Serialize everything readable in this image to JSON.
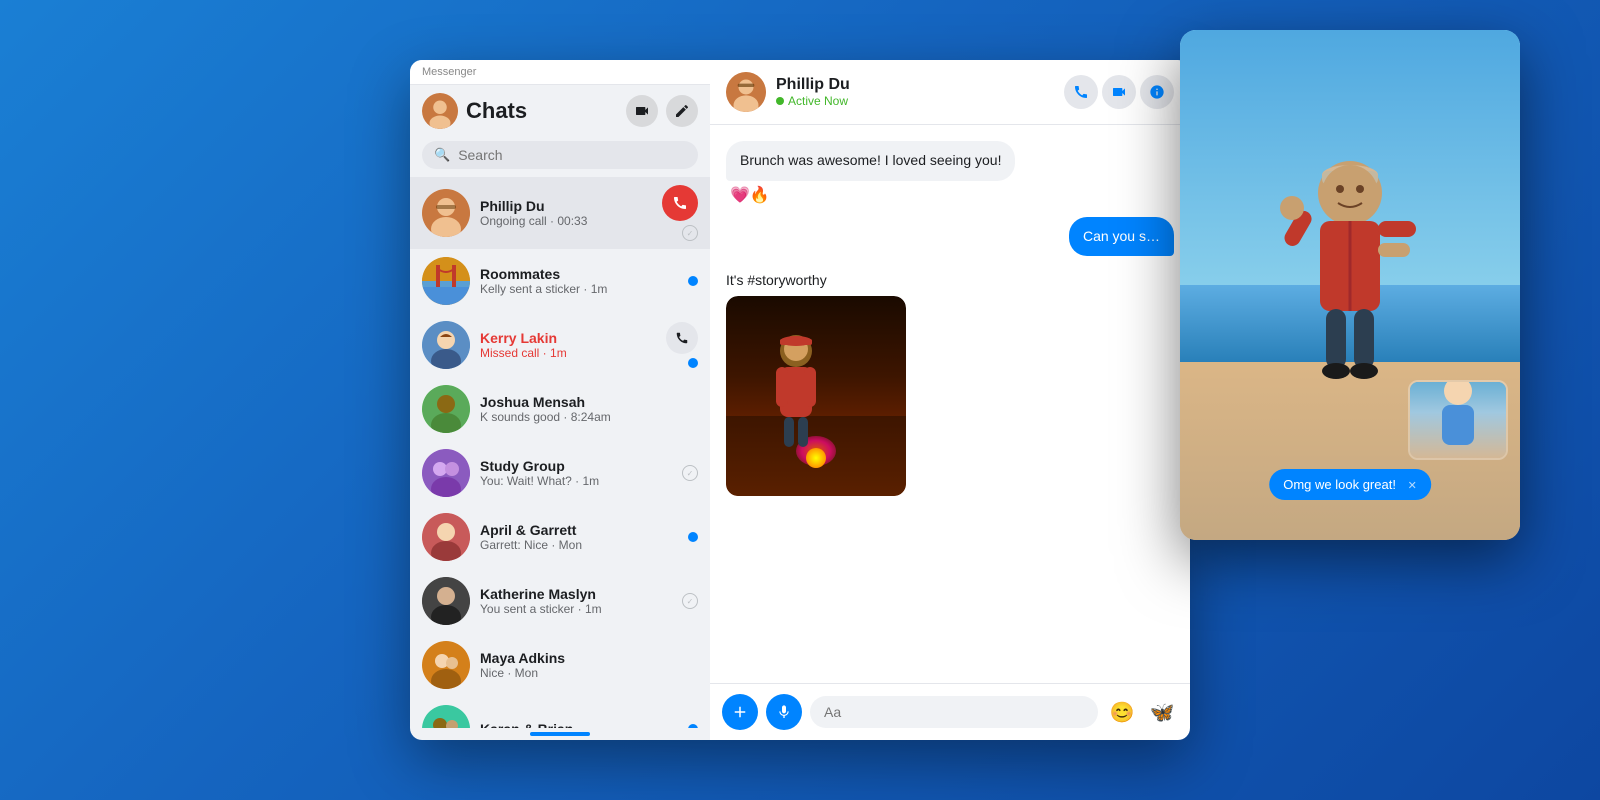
{
  "app": {
    "title": "Messenger",
    "colors": {
      "primary": "#0084ff",
      "unread": "#0084ff",
      "missed": "#e53935",
      "active": "#42b72a",
      "bg": "#f0f2f5",
      "surface": "#ffffff"
    }
  },
  "sidebar": {
    "title": "Messenger",
    "chats_heading": "Chats",
    "search_placeholder": "Search",
    "chats": [
      {
        "id": "phillip",
        "name": "Phillip Du",
        "preview": "Ongoing call · 00:33",
        "avatar_class": "av-phillip",
        "unread": false,
        "ongoing_call": true,
        "has_call_btn": true
      },
      {
        "id": "roommates",
        "name": "Roommates",
        "preview": "Kelly sent a sticker · 1m",
        "avatar_class": "av-roommates",
        "unread": true,
        "ongoing_call": false
      },
      {
        "id": "kerry",
        "name": "Kerry Lakin",
        "preview": "Missed call · 1m",
        "avatar_class": "av-kerry",
        "unread": true,
        "missed_call": true,
        "has_phone": true
      },
      {
        "id": "joshua",
        "name": "Joshua Mensah",
        "preview": "K sounds good · 8:24am",
        "avatar_class": "av-joshua",
        "unread": false
      },
      {
        "id": "study",
        "name": "Study Group",
        "preview": "You: Wait! What? · 1m",
        "avatar_class": "av-study",
        "unread": false,
        "read": true
      },
      {
        "id": "april",
        "name": "April & Garrett",
        "preview": "Garrett: Nice · Mon",
        "avatar_class": "av-april",
        "unread": true
      },
      {
        "id": "katherine",
        "name": "Katherine Maslyn",
        "preview": "You sent a sticker · 1m",
        "avatar_class": "av-katherine",
        "unread": false,
        "read": true
      },
      {
        "id": "maya",
        "name": "Maya Adkins",
        "preview": "Nice · Mon",
        "avatar_class": "av-maya",
        "unread": false
      },
      {
        "id": "karan",
        "name": "Karan & Brian",
        "preview": "",
        "avatar_class": "av-karan",
        "unread": true
      }
    ]
  },
  "chat": {
    "contact_name": "Phillip Du",
    "contact_status": "Active Now",
    "messages": [
      {
        "id": "m1",
        "type": "incoming",
        "text": "Brunch was awesome! I loved seeing you!",
        "reactions": "💗🔥"
      },
      {
        "id": "m2",
        "type": "outgoing",
        "text": "Can you s…"
      },
      {
        "id": "m3",
        "type": "incoming",
        "text": "It's #storyworthy",
        "has_photo": true
      }
    ],
    "input_placeholder": "Aa",
    "call_text": "Omg we look great!",
    "action_buttons": {
      "plus": "➕",
      "mic": "🎤",
      "emoji": "😊",
      "butterfly": "🦋"
    }
  },
  "video_call": {
    "bubble_text": "Omg we look great!",
    "window_buttons": [
      "⬜",
      "⬜",
      "⬜"
    ]
  }
}
